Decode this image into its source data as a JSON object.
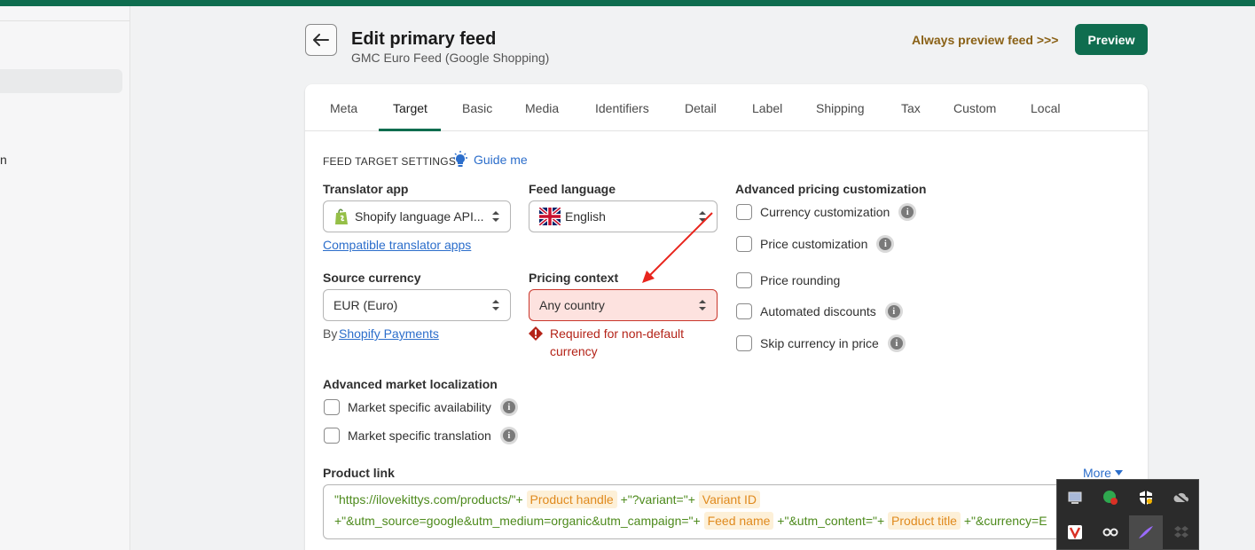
{
  "left_panel": {
    "fragment": "n"
  },
  "header": {
    "title": "Edit primary feed",
    "subtitle": "GMC Euro Feed (Google Shopping)",
    "always_preview": "Always preview feed >>>",
    "preview_button": "Preview"
  },
  "tabs": [
    {
      "label": "Meta"
    },
    {
      "label": "Target"
    },
    {
      "label": "Basic"
    },
    {
      "label": "Media"
    },
    {
      "label": "Identifiers"
    },
    {
      "label": "Detail"
    },
    {
      "label": "Label"
    },
    {
      "label": "Shipping"
    },
    {
      "label": "Tax"
    },
    {
      "label": "Custom"
    },
    {
      "label": "Local"
    }
  ],
  "active_tab": "Target",
  "settings": {
    "section_title": "FEED TARGET SETTINGS",
    "guide_link": "Guide me",
    "translator": {
      "label": "Translator app",
      "value": "Shopify language API...",
      "link": "Compatible translator apps"
    },
    "language": {
      "label": "Feed language",
      "value": "English"
    },
    "source_currency": {
      "label": "Source currency",
      "value": "EUR (Euro)",
      "by": "By",
      "by_link": "Shopify Payments"
    },
    "pricing_context": {
      "label": "Pricing context",
      "value": "Any country",
      "error_line1": "Required for non-default",
      "error_line2": "currency"
    },
    "advanced_pricing": {
      "label": "Advanced pricing customization",
      "options": [
        {
          "label": "Currency customization",
          "checked": false
        },
        {
          "label": "Price customization",
          "checked": false
        },
        {
          "label": "Price rounding",
          "checked": false
        },
        {
          "label": "Automated discounts",
          "checked": false
        },
        {
          "label": "Skip currency in price",
          "checked": false
        }
      ]
    },
    "market_localization": {
      "label": "Advanced market localization",
      "options": [
        {
          "label": "Market specific availability",
          "checked": false
        },
        {
          "label": "Market specific translation",
          "checked": false
        }
      ]
    }
  },
  "product_link": {
    "label": "Product link",
    "more": "More",
    "line1": {
      "lit1": "\"https://ilovekittys.com/products/\"+",
      "tok1": "Product handle",
      "lit2": "+\"?variant=\"+",
      "tok2": "Variant ID"
    },
    "line2": {
      "lit1": "+\"&utm_source=google&utm_medium=organic&utm_campaign=\"+",
      "tok1": "Feed name",
      "lit2": "+\"&utm_content=\"+",
      "tok2": "Product title",
      "lit3": "+\"&currency=E"
    }
  },
  "colors": {
    "brand_green": "#0f6d4f",
    "link_blue": "#2c6ecb",
    "error_red": "#b42318",
    "error_bg": "#fde2df",
    "token_orange": "#e08a1e",
    "literal_green": "#4d8a1c",
    "annotation_arrow": "#e8251d"
  },
  "tray_icons": [
    "monitor-icon",
    "shield-check-icon",
    "security-shield-icon",
    "cloud-offline-icon",
    "vivaldi-icon",
    "link-icon",
    "feather-icon",
    "dropbox-icon"
  ]
}
